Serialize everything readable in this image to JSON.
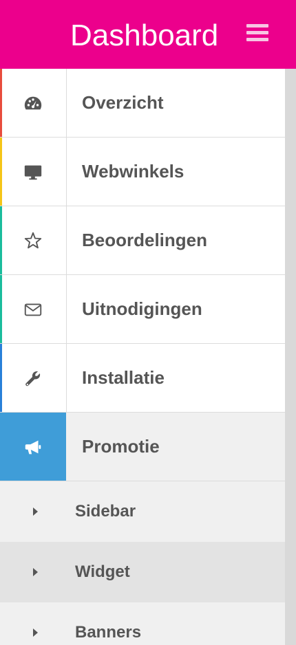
{
  "header": {
    "title": "Dashboard",
    "background": "#ec008c",
    "menu_icon": "hamburger-icon"
  },
  "menu": {
    "items": [
      {
        "label": "Overzicht",
        "icon": "gauge-icon",
        "accent": "#e84c3d"
      },
      {
        "label": "Webwinkels",
        "icon": "monitor-icon",
        "accent": "#f5c518"
      },
      {
        "label": "Beoordelingen",
        "icon": "star-icon",
        "accent": "#1abc9c"
      },
      {
        "label": "Uitnodigingen",
        "icon": "envelope-icon",
        "accent": "#1abc9c"
      },
      {
        "label": "Installatie",
        "icon": "wrench-icon",
        "accent": "#2980d9"
      },
      {
        "label": "Promotie",
        "icon": "megaphone-icon",
        "accent": "#3f9dd8",
        "active": true
      }
    ]
  },
  "submenu": {
    "items": [
      {
        "label": "Sidebar",
        "icon": "caret-right-icon"
      },
      {
        "label": "Widget",
        "icon": "caret-right-icon",
        "highlighted": true
      },
      {
        "label": "Banners",
        "icon": "caret-right-icon"
      }
    ]
  }
}
